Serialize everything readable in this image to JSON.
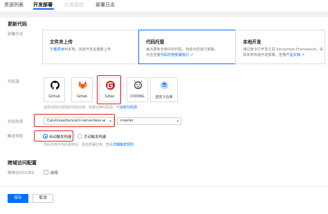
{
  "tabs": [
    {
      "label": "资源列表",
      "state": "normal"
    },
    {
      "label": "开发部署",
      "state": "active"
    },
    {
      "label": "应用监控",
      "state": "disabled"
    },
    {
      "label": "部署日志",
      "state": "normal"
    }
  ],
  "section_update": {
    "title": "更新代码"
  },
  "deploy_mode": {
    "label": "部署方式",
    "options": [
      {
        "title": "文件夹上传",
        "desc_pre": "下载项目",
        "desc_post": "到本地，完成开发后重新上传"
      },
      {
        "title": "代码托管",
        "desc_line1": "每次更新仓库中的代码，自动为您进行部署，",
        "desc_line2_pre": "点击查看",
        "desc_line2_link": "代码托管部署指引"
      },
      {
        "title": "本地开发",
        "desc_line1": "通过命令行开发工具 Serverless Framework，实",
        "desc_line2_pre": "现本地快速开发部署，查看",
        "desc_line2_link": "产品文档"
      }
    ],
    "selected": "代码托管"
  },
  "code_source": {
    "label": "代码源",
    "repos": [
      {
        "name": "Github",
        "icon": "github-icon"
      },
      {
        "name": "Gitlab",
        "icon": "gitlab-icon"
      },
      {
        "name": "Gitee",
        "icon": "gitee-icon"
      },
      {
        "name": "CODING",
        "icon": "coding-icon"
      },
      {
        "name": "自定义仓库",
        "icon": "custom-repo-icon"
      }
    ],
    "selected": "Gitee",
    "hint_pre": "选择当前已授权的代码仓库，如需切换代码源，可",
    "hint_link": "授权代码源"
  },
  "code_repo": {
    "label": "代码仓库",
    "repo_value": "CalvinLee/tencent-serverless-w",
    "branch_value": "master"
  },
  "trigger": {
    "label": "触发规则",
    "options": [
      "自动触发构建",
      "手动触发构建"
    ],
    "selected": "自动触发构建",
    "hint_pre": "代码仓库中代码更新后，自动部署应用，查看",
    "hint_link": "详细触发规则"
  },
  "section_cors": {
    "title": "跨域访问配置"
  },
  "cors": {
    "label": "跨域访问CORS",
    "checkbox_label": "启用",
    "checked": false
  },
  "footer": {
    "save_label": "保存",
    "cancel_label": "取消"
  },
  "colors": {
    "accent": "#006eff",
    "highlight": "#e02020",
    "gitlab": "#e24329",
    "gitee": "#c71d23",
    "coding": "#222222",
    "custom_repo": "#1e6ed8"
  }
}
